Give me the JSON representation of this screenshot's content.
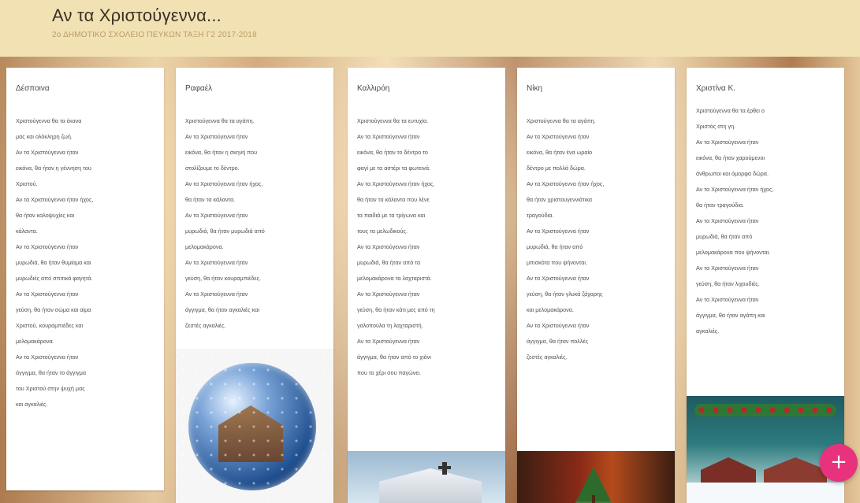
{
  "header": {
    "title": "Αν τα Χριστούγεννα...",
    "subtitle": "2ο ΔΗΜΟΤΙΚΟ ΣΧΟΛΕΙΟ ΠΕΥΚΩΝ ΤΑΞΗ Γ2 2017-2018"
  },
  "columns": [
    {
      "name": "Δέσποινα",
      "text": "Χριστούγεννα θα τα έκανα\nμας και ολόκληρη ζωή.\nΑν τα Χριστούγεννα ήταν\nεικόνα, θα ήταν η γέννηση του\nΧριστού.\nΑν τα Χριστούγεννα ήταν ήχος,\nθα ήταν καλοψυχίες και\nκάλαντα.\nΑν τα Χριστούγεννα ήταν\nμυρωδιά, θα ήταν θυμίαμα και\nμυρωδιές από σπιτικά φαγητά.\nΑν τα Χριστούγεννα ήταν\nγεύση, θα ήταν σώμα και αίμα\nΧριστού, κουραμπιέδες και\nμελομακάρονα.\nΑν τα Χριστούγεννα ήταν\nάγγιγμα, θα ήταν το άγγιγμα\nτου Χριστού στην ψυχή μας\nκαι αγκαλιές."
    },
    {
      "name": "Ραφαέλ",
      "text": "Χριστούγεννα θα τα αγάπη.\nΑν τα Χριστούγεννα ήταν\nεικόνα, θα ήταν η σκηνή που\nστολίζουμε το δέντρο.\nΑν τα Χριστούγεννα ήταν ήχος,\nθα ήταν τα κάλαντα.\nΑν τα Χριστούγεννα ήταν\nμυρωδιά, θα ήταν μυρωδιά από\nμελομακάρονα.\nΑν τα Χριστούγεννα ήταν\nγεύση, θα ήταν κουραμπιέδες.\nΑν τα Χριστούγεννα ήταν\nάγγιγμα, θα ήταν αγκαλιές και\nζεστές αγκαλιές."
    },
    {
      "name": "Καλλιρόη",
      "text": "Χριστούγεννα θα τα ευτυχία.\nΑν τα Χριστούγεννα ήταν\nεικόνα, θα ήταν το δέντρο το\nφαγί με τα αστέρι τα φωτεινά.\nΑν τα Χριστούγεννα ήταν ήχος,\nθα ήταν τα κάλαντα που λένε\nτα παιδιά με τα τρίγωνα και\nτους τα μελωδικούς.\nΑν τα Χριστούγεννα ήταν\nμυρωδιά, θα ήταν από τα\nμελομακάρονα τα λαχταριστά.\nΑν τα Χριστούγεννα ήταν\nγεύση, θα ήταν κάτι μες από τη\nγαλοπούλα τη λαχταριστή.\nΑν τα Χριστούγεννα ήταν\nάγγιγμα, θα ήταν από το χιόνι\nπου το χέρι σου παγώνει."
    },
    {
      "name": "Νίκη",
      "text": "Χριστούγεννα θα τα αγάπη.\nΑν τα Χριστούγεννα ήταν\nεικόνα, θα ήταν ένα ωραίο\nδέντρο με πολλά δώρα.\nΑν τα Χριστούγεννα ήταν ήχος,\nθα ήταν χριστουγεννιάτικα\nτραγούδια.\nΑν τα Χριστούγεννα ήταν\nμυρωδιά, θα ήταν από\nμπισκότα που ψήνονται.\nΑν τα Χριστούγεννα ήταν\nγεύση, θα ήταν γλυκά ζάχαρης\nκαι μελομακάρονα.\nΑν τα Χριστούγεννα ήταν\nάγγιγμα, θα ήταν πολλές\nζεστές αγκαλιές."
    },
    {
      "name": "Χριστίνα Κ.",
      "text": "Χριστούγεννα θα τα έρθει ο\nΧριστός στη γη.\nΑν τα Χριστούγεννα ήταν\nεικόνα, θα ήταν χαρούμενοι\nάνθρωποι και όμορφα δώρα.\nΑν τα Χριστούγεννα ήταν ήχος,\nθα ήταν τραγούδια.\nΑν τα Χριστούγεννα ήταν\nμυρωδιά, θα ήταν από\nμελομακάρονα που ψήνονται.\nΑν τα Χριστούγεννα ήταν\nγεύση, θα ήταν λιχουδιές.\nΑν τα Χριστούγεννα ήταν\nάγγιγμα, θα ήταν αγάπη και\nαγκαλιές."
    }
  ],
  "fab": {
    "label": "+"
  }
}
